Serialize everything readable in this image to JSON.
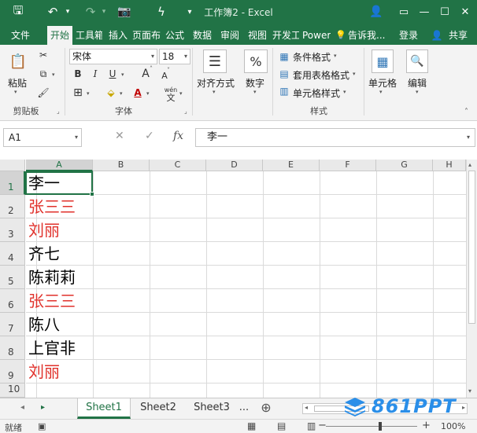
{
  "titlebar": {
    "title": "工作簿2 - Excel",
    "icons": [
      "save-icon",
      "undo-icon",
      "redo-icon",
      "camera-icon",
      "format-painter-icon",
      "qat-dropdown-icon",
      "account-icon",
      "ribbon-display-icon",
      "minimize-icon",
      "maximize-icon",
      "close-icon"
    ],
    "glyphs": {
      "save": "🖫",
      "undo": "↶",
      "redo": "↷",
      "camera": "📷",
      "painter": "ϟ",
      "dropdown": "▾",
      "account": "👤",
      "display": "▭",
      "min": "—",
      "max": "☐",
      "close": "✕",
      "caret": "▾"
    }
  },
  "tabs": {
    "file": "文件",
    "home": "开始",
    "tools": "工具箱",
    "insert": "插入",
    "layout": "页面布局",
    "formulas": "公式",
    "data": "数据",
    "review": "审阅",
    "view": "视图",
    "developer": "开发工具",
    "power": "Power",
    "tellme": "告诉我...",
    "signin": "登录",
    "share": "共享",
    "tellme_icon": "💡",
    "share_icon": "👤"
  },
  "ribbon": {
    "clipboard": {
      "paste": "粘贴",
      "label": "剪贴板",
      "glyphs": {
        "paste": "📋",
        "cut": "✂",
        "copy": "⧉",
        "painter": "🖌"
      }
    },
    "font": {
      "name": "宋体",
      "size": "18",
      "bold": "B",
      "italic": "I",
      "underline": "U",
      "grow": "A",
      "shrink": "A",
      "grow_mark": "˄",
      "shrink_mark": "˅",
      "border_glyph": "⊞",
      "fill_glyph": "⬙",
      "color_glyph": "A",
      "phonetic": "wén",
      "phonetic_glyph": "文",
      "label": "字体"
    },
    "alignment": {
      "label": "对齐方式",
      "glyph": "☰"
    },
    "number": {
      "label": "数字",
      "glyph": "%"
    },
    "styles": {
      "conditional": "条件格式",
      "table": "套用表格格式",
      "cell": "单元格样式",
      "label": "样式",
      "glyphs": {
        "conditional": "▦",
        "table": "▤",
        "cell": "▥"
      }
    },
    "cells": {
      "label": "单元格",
      "glyph": "▦"
    },
    "editing": {
      "label": "编辑",
      "glyph": "🔍"
    },
    "launcher_glyph": "⌟",
    "caret": "▾",
    "collapse_glyph": "˄"
  },
  "formula_bar": {
    "name_box": "A1",
    "cancel": "✕",
    "enter": "✓",
    "fx": "fx",
    "value": "李一",
    "caret": "▾"
  },
  "sheet": {
    "columns": [
      "A",
      "B",
      "C",
      "D",
      "E",
      "F",
      "G",
      "H"
    ],
    "rows": [
      "1",
      "2",
      "3",
      "4",
      "5",
      "6",
      "7",
      "8",
      "9",
      "10"
    ],
    "cells_a": [
      {
        "text": "李一",
        "color": "#000000"
      },
      {
        "text": "张三三",
        "color": "#e0312b"
      },
      {
        "text": "刘丽",
        "color": "#e0312b"
      },
      {
        "text": "齐七",
        "color": "#000000"
      },
      {
        "text": "陈莉莉",
        "color": "#000000"
      },
      {
        "text": "张三三",
        "color": "#e0312b"
      },
      {
        "text": "陈八",
        "color": "#000000"
      },
      {
        "text": "上官非",
        "color": "#000000"
      },
      {
        "text": "刘丽",
        "color": "#e0312b"
      }
    ],
    "selected_cell": "A1",
    "accent": "#217346"
  },
  "sheet_tabs": {
    "tabs": [
      "Sheet1",
      "Sheet2",
      "Sheet3"
    ],
    "more": "...",
    "add": "⊕",
    "nav_prev": "◂",
    "nav_next": "▸",
    "scroll_left": "◂",
    "scroll_right": "▸",
    "scroll_up": "▴",
    "scroll_down": "▾"
  },
  "watermark": {
    "text": "861PPT",
    "color": "#2a8ee8"
  },
  "status": {
    "ready": "就绪",
    "macro_glyph": "▣",
    "views": {
      "normal": "▦",
      "layout": "▤",
      "pagebreak": "▥"
    },
    "minus": "−",
    "plus": "+",
    "zoom": "100%"
  }
}
